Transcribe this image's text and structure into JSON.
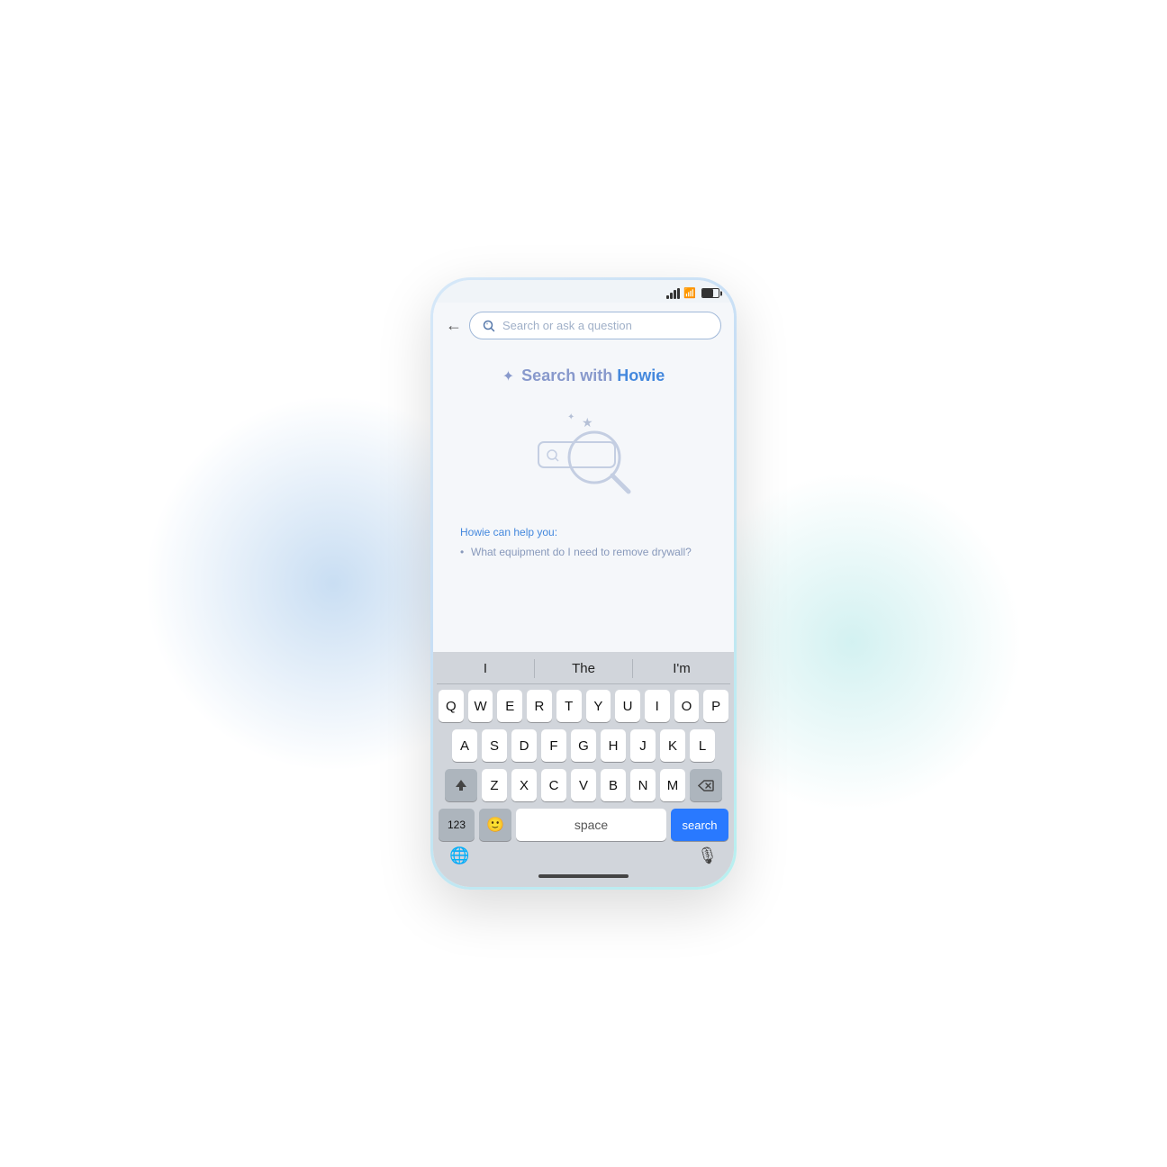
{
  "page": {
    "bg": "white"
  },
  "status_bar": {
    "battery_label": "battery",
    "wifi_label": "wifi",
    "signal_label": "signal"
  },
  "header": {
    "back_label": "←",
    "search_placeholder": "Search or ask a question"
  },
  "main": {
    "title_prefix": "Search with ",
    "title_brand": "Howie",
    "howie_can_help": "Howie can help you:",
    "help_items": [
      "What equipment do I need to remove drywall?"
    ]
  },
  "keyboard": {
    "suggestions": [
      "I",
      "The",
      "I'm"
    ],
    "rows": [
      [
        "Q",
        "W",
        "E",
        "R",
        "T",
        "Y",
        "U",
        "I",
        "O",
        "P"
      ],
      [
        "A",
        "S",
        "D",
        "F",
        "G",
        "H",
        "J",
        "K",
        "L"
      ],
      [
        "⇧",
        "Z",
        "X",
        "C",
        "V",
        "B",
        "N",
        "M",
        "⌫"
      ]
    ],
    "bottom_row": {
      "numbers": "123",
      "space": "space",
      "search": "search"
    }
  }
}
